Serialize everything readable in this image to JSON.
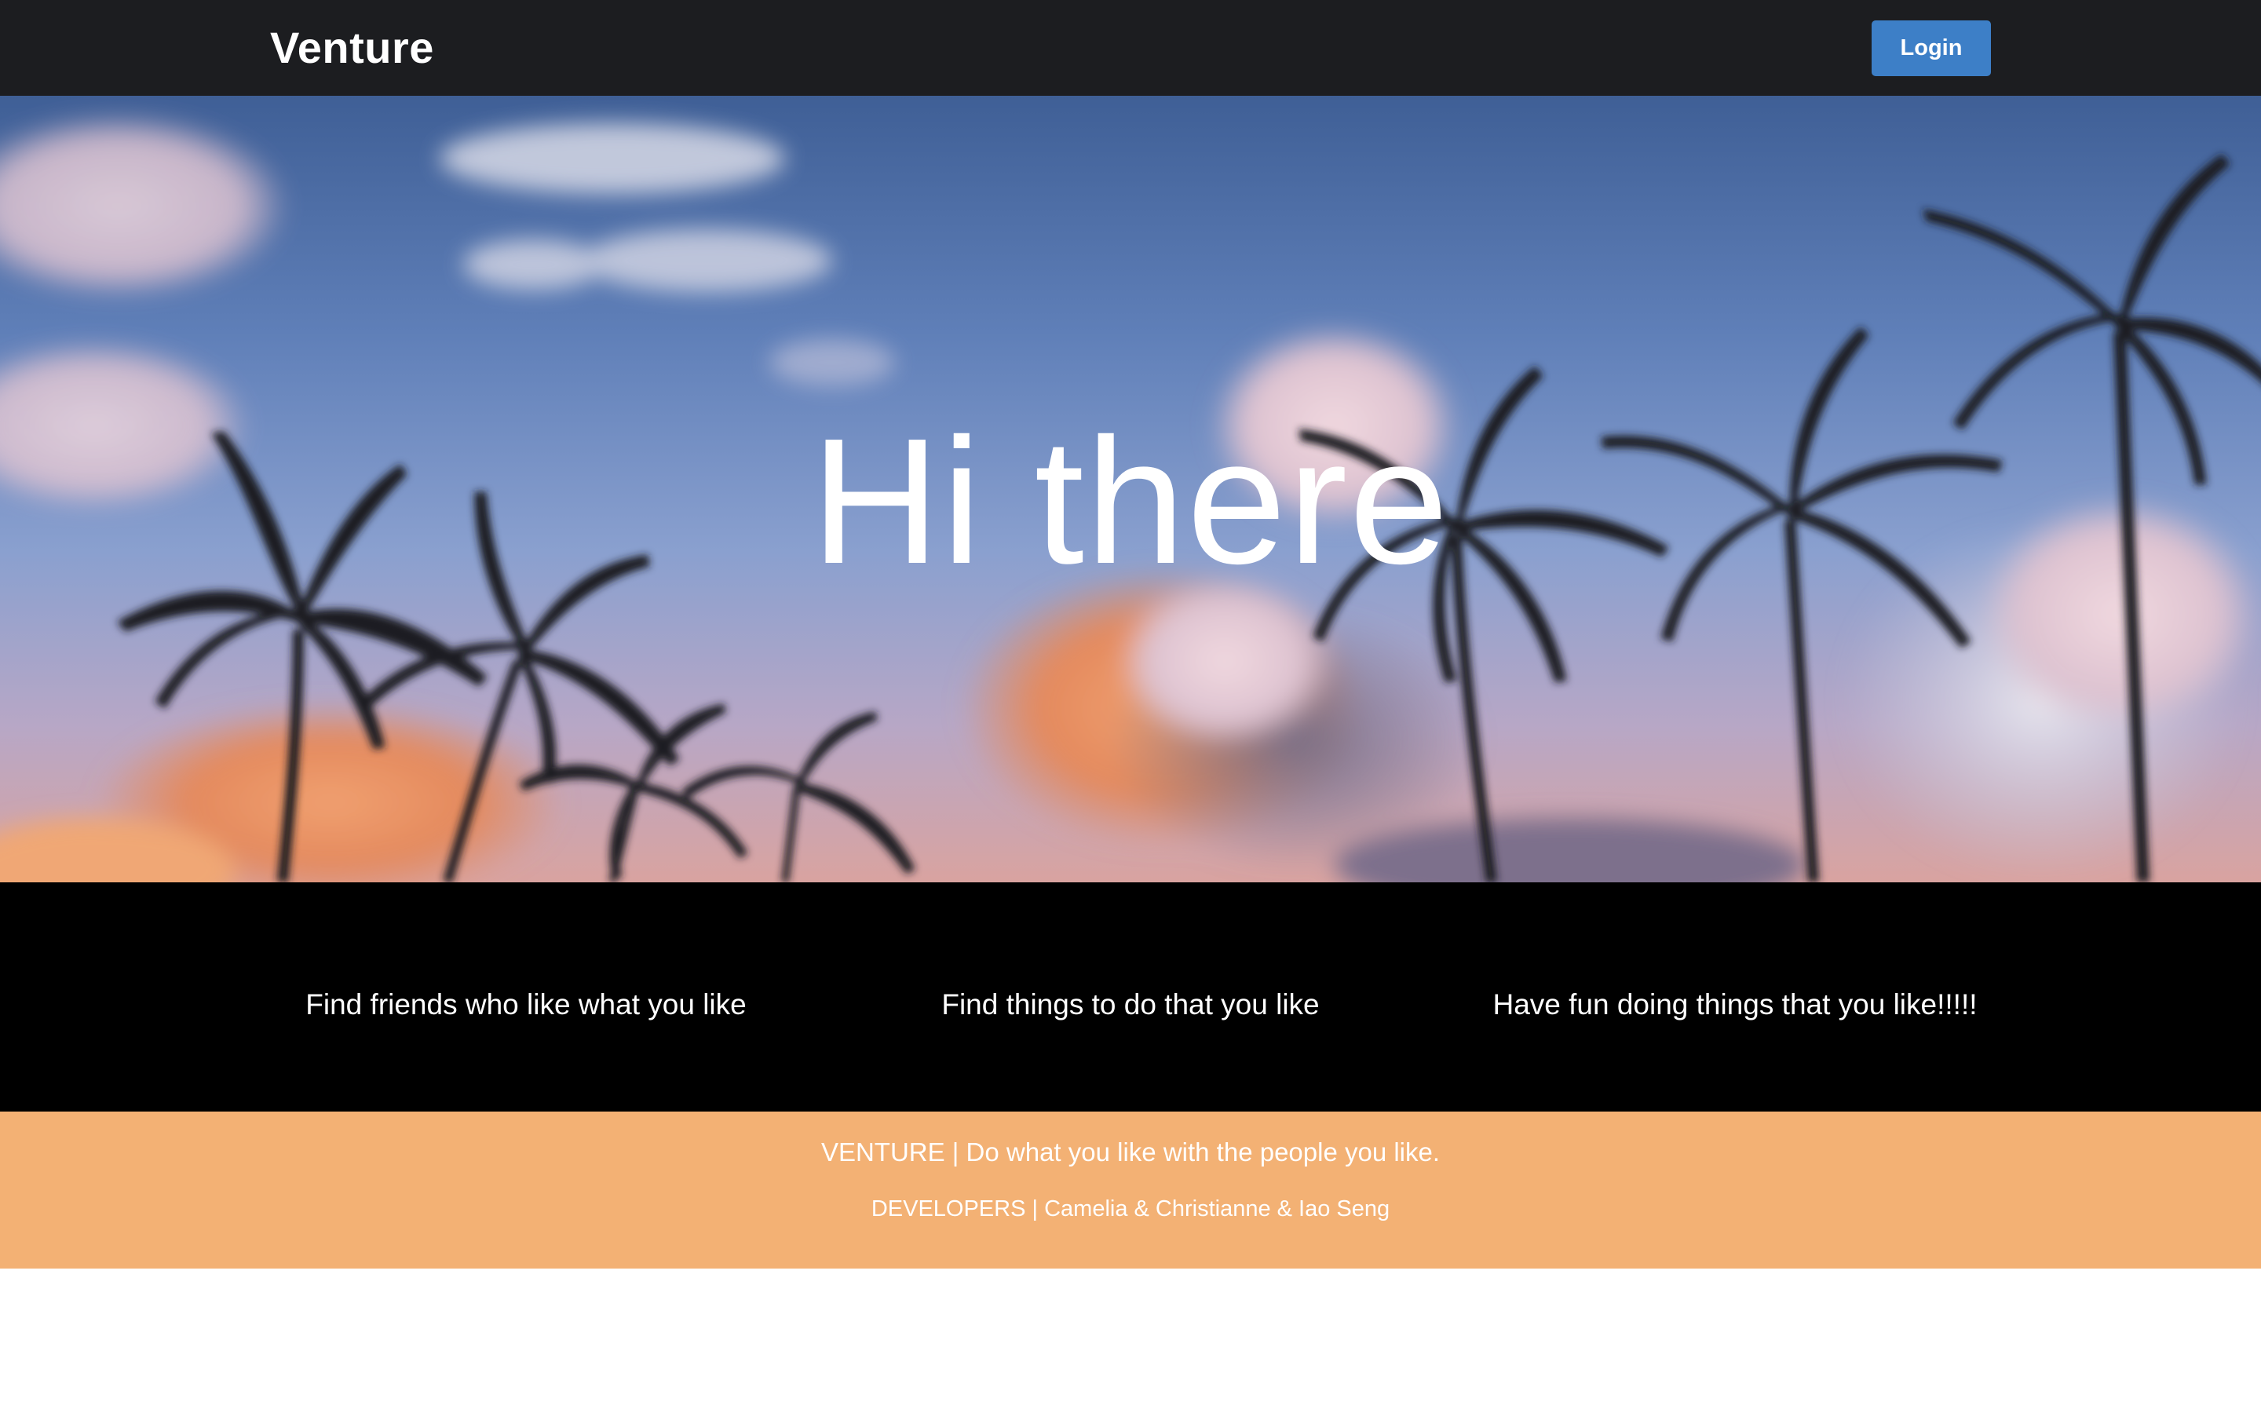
{
  "navbar": {
    "brand": "Venture",
    "login_label": "Login"
  },
  "hero": {
    "title": "Hi there"
  },
  "features": [
    {
      "text": "Find friends who like what you like"
    },
    {
      "text": "Find things to do that you like"
    },
    {
      "text": "Have fun doing things that you like!!!!!"
    }
  ],
  "footer": {
    "tagline": "VENTURE | Do what you like with the people you like.",
    "developers": "DEVELOPERS | Camelia & Christianne & Iao Seng"
  },
  "colors": {
    "navbar_bg": "#1c1d20",
    "login_button": "#3d7fc7",
    "features_bg": "#000000",
    "footer_bg": "#f3b174"
  }
}
